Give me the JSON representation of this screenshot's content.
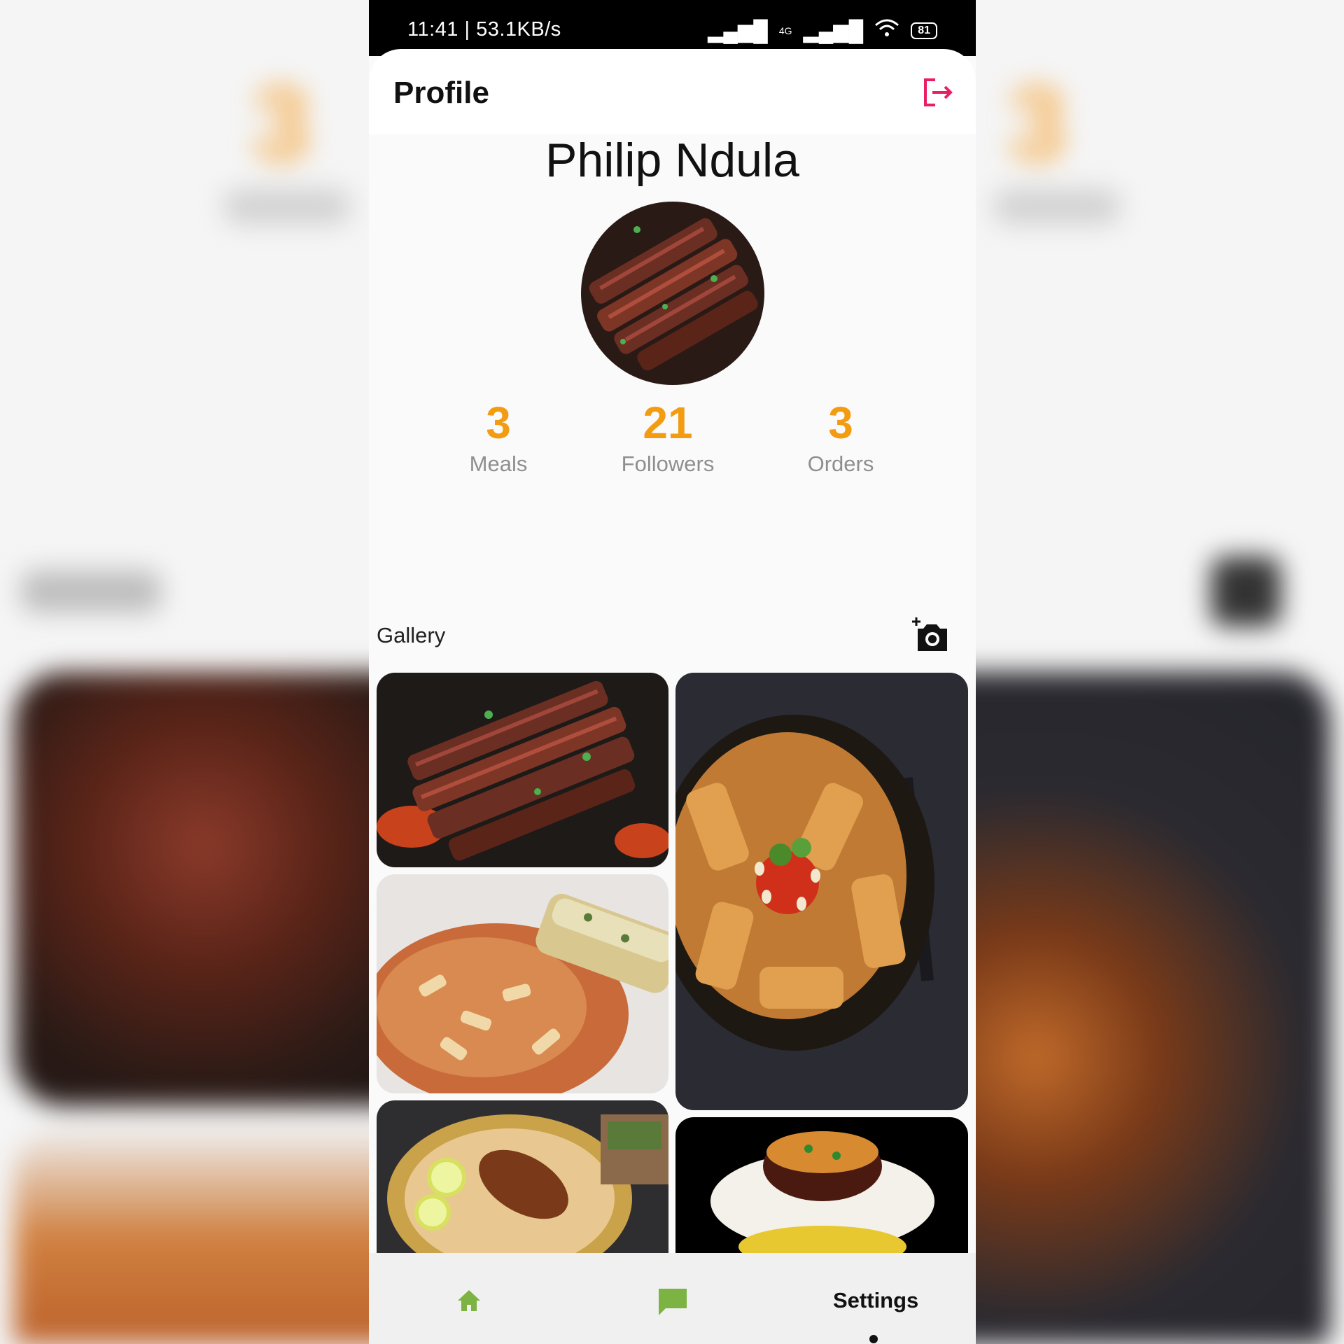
{
  "status_bar": {
    "time": "11:41 | 53.1KB/s",
    "network": "4G",
    "battery": "81"
  },
  "app_bar": {
    "title": "Profile",
    "logout_icon": "logout-icon",
    "accent_color": "#e91e63"
  },
  "profile": {
    "name": "Philip Ndula",
    "avatar_image": "grilled steak slices"
  },
  "stats": [
    {
      "value": "3",
      "label": "Meals"
    },
    {
      "value": "21",
      "label": "Followers"
    },
    {
      "value": "3",
      "label": "Orders"
    }
  ],
  "stat_color": "#f39c12",
  "gallery": {
    "title": "Gallery",
    "add_icon": "add-photo-icon",
    "images": [
      "grilled steak slices",
      "baked pasta with garlic bread",
      "rigatoni in coconut bowl",
      "chicken biryani platter",
      "rice dish on plate"
    ]
  },
  "bottom_nav": {
    "home_icon": "home-icon",
    "chat_icon": "chat-icon",
    "settings_label": "Settings",
    "active_color": "#7cb342"
  },
  "background_echo": {
    "left_value": "3",
    "right_value": "3"
  }
}
